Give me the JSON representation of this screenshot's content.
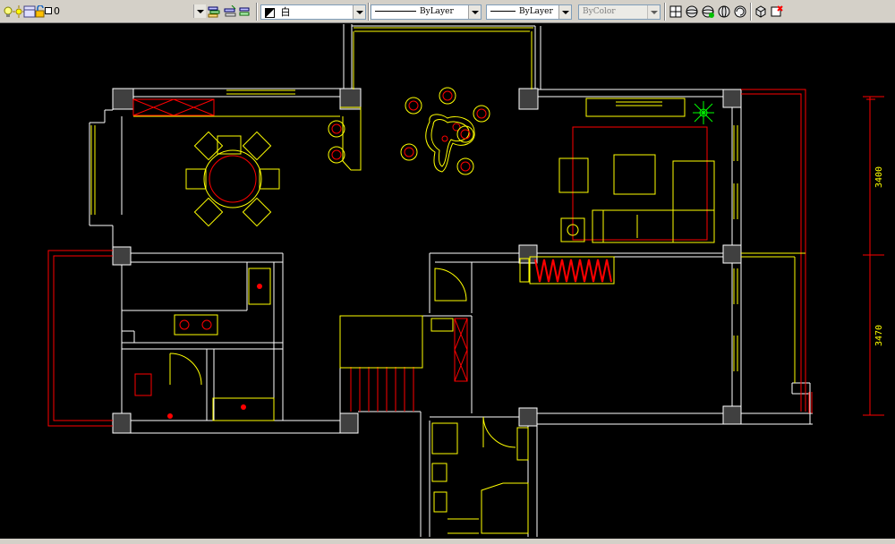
{
  "toolbar": {
    "layer_name": "0",
    "color_name": "白",
    "linetype": "ByLayer",
    "lineweight": "ByLayer",
    "plotstyle": "ByColor"
  },
  "dimensions": {
    "upper": "3400",
    "lower": "3470"
  },
  "colors": {
    "background": "#000000",
    "walls": "#ffffff",
    "furniture": "#ffff00",
    "accent": "#ff0000",
    "plant": "#00ff00",
    "toolbar": "#d4d0c8"
  }
}
